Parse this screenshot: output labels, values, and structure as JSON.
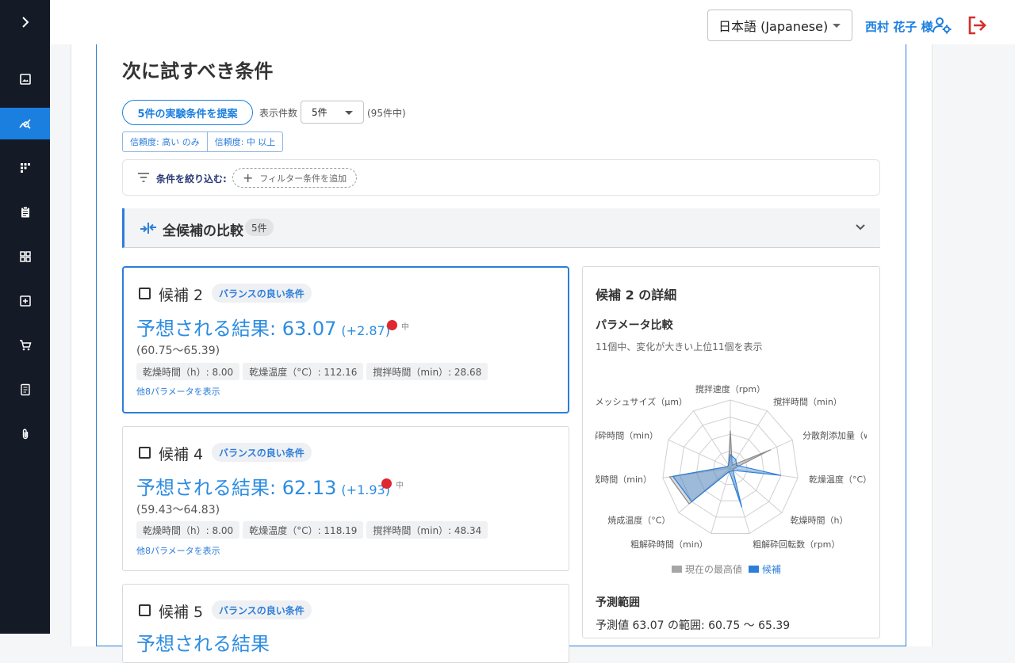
{
  "sidebar": {
    "items": [
      {
        "icon": "chevron-right-icon"
      },
      {
        "icon": "image-icon"
      },
      {
        "icon": "analysis-icon",
        "active": true
      },
      {
        "icon": "grid-dots-icon"
      },
      {
        "icon": "clipboard-icon"
      },
      {
        "icon": "dashboard-icon"
      },
      {
        "icon": "add-box-icon"
      },
      {
        "icon": "cart-icon"
      },
      {
        "icon": "document-icon"
      },
      {
        "icon": "attachment-icon"
      }
    ]
  },
  "header": {
    "language": "日本語 (Japanese)",
    "user_name": "西村 花子 様"
  },
  "page": {
    "title": "次に試すべき条件",
    "propose_button": "5件の実験条件を提案",
    "count_label": "表示件数",
    "count_value": "5件",
    "count_total": "(95件中)",
    "confidence_buttons": [
      "信頼度: 高い のみ",
      "信頼度: 中 以上"
    ],
    "filter_label": "条件を絞り込む:",
    "filter_add": "フィルター条件を追加",
    "compare_title": "全候補の比較",
    "compare_count": "5件"
  },
  "candidates": [
    {
      "name": "候補 2",
      "tag": "バランスの良い条件",
      "prediction": "予想される結果: 63.07",
      "delta": "(+2.87)",
      "confidence": "中",
      "range": "(60.75〜65.39)",
      "params": [
        "乾燥時間（h）: 8.00",
        "乾燥温度（°C）: 112.16",
        "撹拌時間（min）: 28.68"
      ],
      "more": "他8パラメータを表示"
    },
    {
      "name": "候補 4",
      "tag": "バランスの良い条件",
      "prediction": "予想される結果: 62.13",
      "delta": "(+1.93)",
      "confidence": "中",
      "range": "(59.43〜64.83)",
      "params": [
        "乾燥時間（h）: 8.00",
        "乾燥温度（°C）: 118.19",
        "撹拌時間（min）: 48.34"
      ],
      "more": "他8パラメータを表示"
    },
    {
      "name": "候補 5",
      "tag": "バランスの良い条件",
      "prediction": "予想される結果"
    }
  ],
  "detail": {
    "title": "候補 2 の詳細",
    "subtitle": "パラメータ比較",
    "note": "11個中、変化が大きい上位11個を表示",
    "legend_best": "現在の最高値",
    "legend_candidate": "候補",
    "range_title": "予測範囲",
    "range_text": "予測値 63.07 の範囲: 60.75 〜 65.39"
  },
  "colors": {
    "accent": "#1b7fe0",
    "sidebar_bg": "#141a26",
    "confidence_dot": "#e0262e",
    "logout": "#d32f2f"
  },
  "chart_data": {
    "type": "radar",
    "axes": [
      "撹拌速度（rpm）",
      "撹拌時間（min）",
      "分散剤添加量（wt%）",
      "乾燥温度（°C）",
      "乾燥時間（h）",
      "粗解砕回転数（rpm）",
      "粗解砕時間（min）",
      "焼成温度（°C）",
      "焼成時間（min）",
      "微粉解砕時間（min）",
      "篩メッシュサイズ（μm）"
    ],
    "axis_labels_shown": [
      "撹拌速度（rpm）",
      "撹拌時間（min）",
      "分散剤添加量（w",
      "乾燥温度（°C）",
      "乾燥時間（h）",
      "粗解砕回転数（rpm）",
      "粗解砕時間（min）",
      "焼成温度（°C）",
      "成時間（min）",
      "解砕時間（min）",
      "篩メッシュサイズ（μm）"
    ],
    "rmax": 1,
    "series": [
      {
        "name": "現在の最高値",
        "values": [
          0.55,
          0.05,
          0.65,
          0.05,
          0.05,
          0.05,
          0.05,
          0.8,
          0.9,
          0.05,
          0.05
        ]
      },
      {
        "name": "候補",
        "values": [
          0.2,
          0.15,
          0.1,
          0.75,
          0.05,
          0.6,
          0.05,
          0.75,
          0.85,
          0.05,
          0.05
        ]
      }
    ]
  }
}
